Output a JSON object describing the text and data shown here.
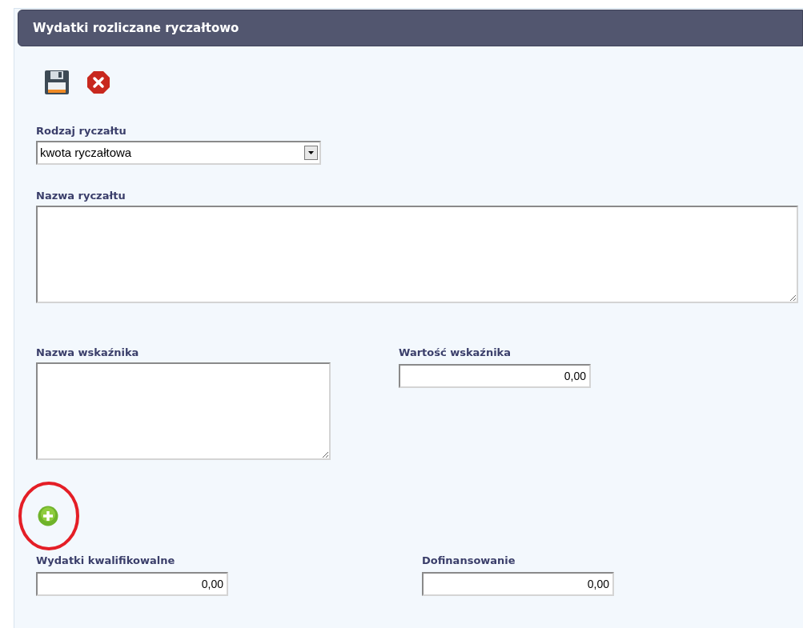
{
  "panel_title": "Wydatki rozliczane ryczałtowo",
  "toolbar": [
    {
      "kind": "save"
    },
    {
      "kind": "cancel"
    }
  ],
  "lump_sum_type": {
    "label": "Rodzaj ryczałtu",
    "value": "kwota ryczałtowa"
  },
  "lump_sum_name": {
    "label": "Nazwa ryczałtu"
  },
  "indicator_name": {
    "label": "Nazwa wskaźnika"
  },
  "indicator_value": {
    "label": "Wartość wskaźnika",
    "value": "0,00"
  },
  "add_button": {
    "highlighted": true
  },
  "eligible_expenses": {
    "label": "Wydatki kwalifikowalne",
    "value": "0,00"
  },
  "co_financing": {
    "label": "Dofinansowanie",
    "value": "0,00"
  }
}
